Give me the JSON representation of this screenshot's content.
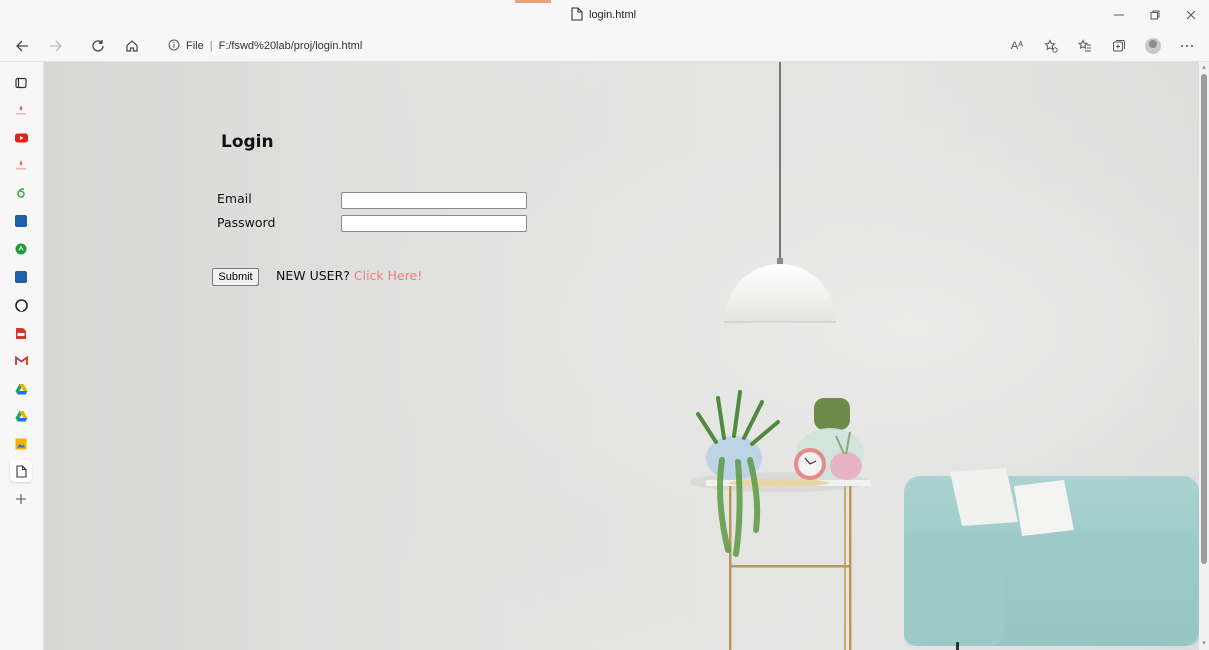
{
  "tab": {
    "title": "login.html"
  },
  "address": {
    "scheme": "File",
    "url": "F:/fswd%20lab/proj/login.html"
  },
  "toolbar": {
    "read_aloud": "Aᴬ"
  },
  "page": {
    "login_title": "Login",
    "email_label": "Email",
    "password_label": "Password",
    "submit_label": "Submit",
    "new_user_text": "NEW USER?",
    "click_here_text": "Click Here!"
  },
  "sidebar": {
    "items": [
      {
        "icon": "tab-actions-icon",
        "color": "#333333"
      },
      {
        "icon": "app-logo-icon",
        "color": "#e56a5a"
      },
      {
        "icon": "youtube-icon",
        "color": "#e62117"
      },
      {
        "icon": "app-logo-icon",
        "color": "#e56a5a"
      },
      {
        "icon": "app-icon",
        "color": "#3fa34d"
      },
      {
        "icon": "ieee-icon",
        "color": "#1f5fa8"
      },
      {
        "icon": "app-icon",
        "color": "#1d9a3b"
      },
      {
        "icon": "ieee-icon",
        "color": "#1f5fa8"
      },
      {
        "icon": "github-icon",
        "color": "#222222"
      },
      {
        "icon": "pdf-icon",
        "color": "#d9342b"
      },
      {
        "icon": "gmail-icon",
        "color": "#d93025"
      },
      {
        "icon": "drive-icon",
        "color": "#1a73e8"
      },
      {
        "icon": "drive-icon",
        "color": "#1a73e8"
      },
      {
        "icon": "photos-icon",
        "color": "#f2b100"
      },
      {
        "icon": "page-icon",
        "color": "#333333"
      },
      {
        "icon": "add-icon",
        "color": "#555555"
      }
    ]
  }
}
